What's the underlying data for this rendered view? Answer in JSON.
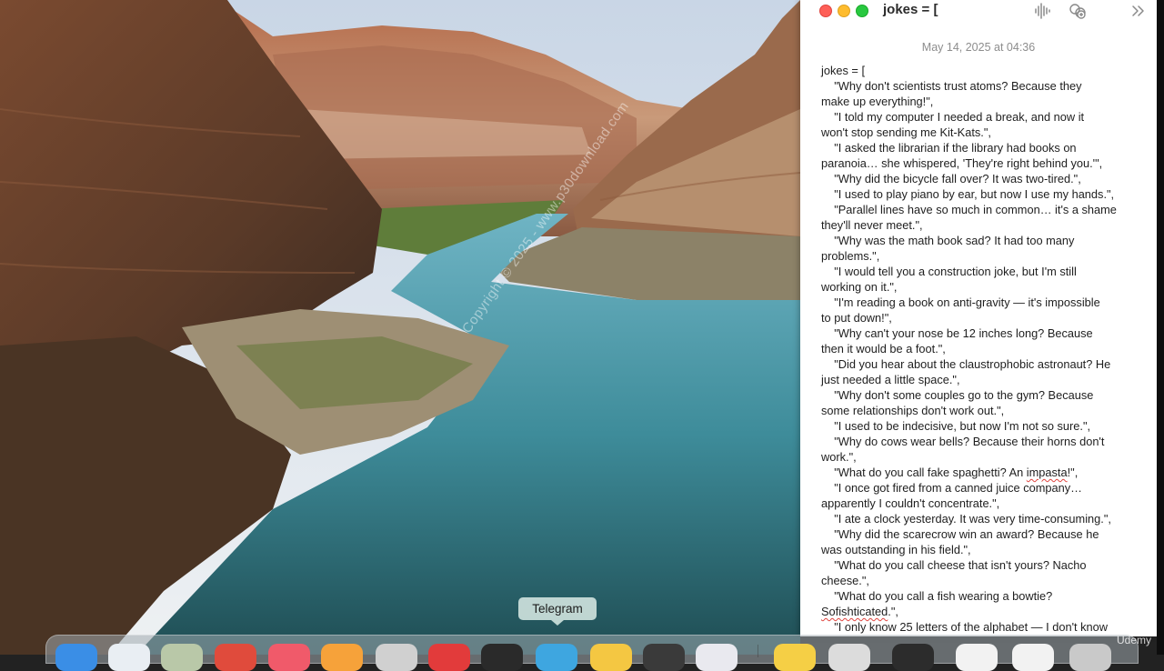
{
  "window": {
    "title": "jokes = [",
    "date": "May 14, 2025 at 04:36"
  },
  "note_lines": [
    "jokes = [",
    "    \"Why don't scientists trust atoms? Because they",
    "make up everything!\",",
    "    \"I told my computer I needed a break, and now it",
    "won't stop sending me Kit-Kats.\",",
    "    \"I asked the librarian if the library had books on",
    "paranoia… she whispered, 'They're right behind you.'\",",
    "    \"Why did the bicycle fall over? It was two-tired.\",",
    "    \"I used to play piano by ear, but now I use my hands.\",",
    "    \"Parallel lines have so much in common… it's a shame",
    "they'll never meet.\",",
    "    \"Why was the math book sad? It had too many",
    "problems.\",",
    "    \"I would tell you a construction joke, but I'm still",
    "working on it.\",",
    "    \"I'm reading a book on anti-gravity — it's impossible",
    "to put down!\",",
    "    \"Why can't your nose be 12 inches long? Because",
    "then it would be a foot.\",",
    "    \"Did you hear about the claustrophobic astronaut? He",
    "just needed a little space.\",",
    "    \"Why don't some couples go to the gym? Because",
    "some relationships don't work out.\",",
    "    \"I used to be indecisive, but now I'm not so sure.\",",
    "    \"Why do cows wear bells? Because their horns don't",
    "work.\","
  ],
  "impasta_line": {
    "before": "    \"What do you call fake spaghetti? An ",
    "word": "impasta",
    "after": "!\","
  },
  "note_lines_after": [
    "    \"I once got fired from a canned juice company…",
    "apparently I couldn't concentrate.\",",
    "    \"I ate a clock yesterday. It was very time-consuming.\",",
    "    \"Why did the scarecrow win an award? Because he",
    "was outstanding in his field.\",",
    "    \"What do you call cheese that isn't yours? Nacho",
    "cheese.\",",
    "    \"What do you call a fish wearing a bowtie?"
  ],
  "sofishticated_line": {
    "word": "Sofishticated",
    "after": ".\","
  },
  "last_line": "    \"I only know 25 letters of the alphabet — I don't know",
  "watermark": "Copyright © 2025 - www.p30download.com",
  "tooltip": "Telegram",
  "badge": "Udemy",
  "icons": [
    "waveform-icon",
    "collaborate-icon",
    "more-chevron-icon"
  ],
  "colors": {
    "close": "#fe5f57",
    "minimize": "#febc2e",
    "maximize": "#28c840"
  }
}
